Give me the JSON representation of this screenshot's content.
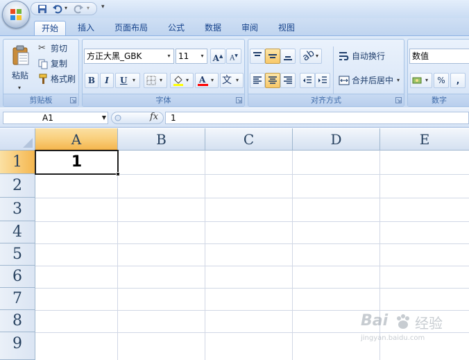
{
  "colors": {
    "ribbon_bg": "#d3e3f7",
    "selected_header": "#f9cf7c",
    "grid_line": "#d0d7e5",
    "text_blue": "#15428b"
  },
  "title_bar": {
    "office_button_icon": "office-logo-icon",
    "quick_access": [
      "save-icon",
      "undo-icon",
      "redo-icon"
    ],
    "customize_icon": "qat-customize-icon"
  },
  "tabs": [
    {
      "label": "开始",
      "active": true
    },
    {
      "label": "插入"
    },
    {
      "label": "页面布局"
    },
    {
      "label": "公式"
    },
    {
      "label": "数据"
    },
    {
      "label": "审阅"
    },
    {
      "label": "视图"
    }
  ],
  "ribbon": {
    "clipboard": {
      "label": "剪贴板",
      "paste": "粘贴",
      "cut": "剪切",
      "copy": "复制",
      "format_painter": "格式刷"
    },
    "font": {
      "label": "字体",
      "font_name": "方正大黑_GBK",
      "font_size": "11",
      "bold": "B",
      "italic": "I",
      "underline": "U",
      "font_color_letter": "A",
      "wen": "文",
      "grow_letter": "A",
      "shrink_letter": "A"
    },
    "alignment": {
      "label": "对齐方式",
      "wrap_text": "自动换行",
      "merge_center": "合并后居中"
    },
    "number": {
      "label": "数字",
      "format": "数值",
      "percent": "%",
      "comma": ","
    }
  },
  "formula_bar": {
    "name_box": "A1",
    "fx": "fx",
    "value": "1"
  },
  "grid": {
    "columns": [
      "A",
      "B",
      "C",
      "D",
      "E"
    ],
    "rows": [
      "1",
      "2",
      "3",
      "4",
      "5",
      "6",
      "7",
      "8",
      "9"
    ],
    "selected_column": "A",
    "selected_row": "1",
    "cells": {
      "A1": "1"
    }
  },
  "watermark": {
    "brand": "Bai",
    "brand2": "经验",
    "url": "jingyan.baidu.com"
  }
}
